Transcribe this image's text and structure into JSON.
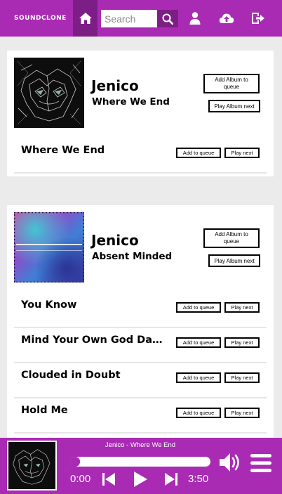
{
  "header": {
    "logo": "SOUNDCLONE",
    "search": {
      "placeholder": "Search",
      "value": ""
    },
    "icons": [
      "home-icon",
      "search-icon",
      "user-icon",
      "upload-icon",
      "logout-icon"
    ],
    "accent_color": "#a92bb4",
    "accent_dark": "#7d1e86"
  },
  "albums": [
    {
      "artist": "Jenico",
      "title": "Where We End",
      "add_album_label": "Add Album to queue",
      "play_album_label": "Play Album next",
      "tracks": [
        {
          "title": "Where We End",
          "add_label": "Add to queue",
          "next_label": "Play next"
        }
      ]
    },
    {
      "artist": "Jenico",
      "title": "Absent Minded",
      "add_album_label": "Add Album to queue",
      "play_album_label": "Play Album next",
      "tracks": [
        {
          "title": "You Know",
          "add_label": "Add to queue",
          "next_label": "Play next"
        },
        {
          "title": "Mind Your Own God Dam...",
          "add_label": "Add to queue",
          "next_label": "Play next"
        },
        {
          "title": "Clouded in Doubt",
          "add_label": "Add to queue",
          "next_label": "Play next"
        },
        {
          "title": "Hold Me",
          "add_label": "Add to queue",
          "next_label": "Play next"
        }
      ]
    }
  ],
  "player": {
    "now_playing": "Jenico - Where We End",
    "current_time": "0:00",
    "total_time": "3:50",
    "progress": 0,
    "icons": [
      "previous-icon",
      "play-icon",
      "next-icon",
      "volume-icon",
      "menu-icon"
    ]
  }
}
